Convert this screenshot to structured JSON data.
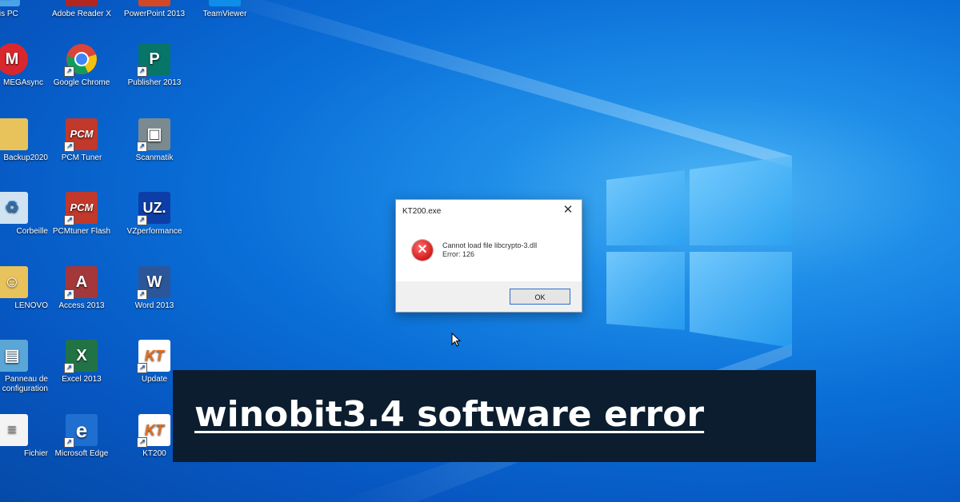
{
  "desktop": {
    "icons": [
      {
        "label": "This PC",
        "icon": "computer-icon"
      },
      {
        "label": "Adobe Reader X",
        "icon": "pdf-icon"
      },
      {
        "label": "PowerPoint 2013",
        "icon": "powerpoint-icon"
      },
      {
        "label": "TeamViewer",
        "icon": "teamviewer-icon"
      },
      {
        "label": "MEGAsync",
        "icon": "mega-icon",
        "color": "#d9272e",
        "glyph": "M"
      },
      {
        "label": "Google Chrome",
        "icon": "chrome-icon"
      },
      {
        "label": "Publisher 2013",
        "icon": "publisher-icon",
        "color": "#077568",
        "glyph": "P"
      },
      {
        "label": "Backup2020",
        "icon": "folder-icon"
      },
      {
        "label": "PCM Tuner",
        "icon": "pcm-tuner-icon",
        "color": "#c0392b",
        "glyph": "PCM"
      },
      {
        "label": "Scanmatik",
        "icon": "scanmatik-icon"
      },
      {
        "label": "Corbeille",
        "icon": "recycle-bin-icon"
      },
      {
        "label": "PCMtuner Flash",
        "icon": "pcm-flash-icon",
        "color": "#c0392b",
        "glyph": "PCM"
      },
      {
        "label": "VZperformance",
        "icon": "vz-icon",
        "color": "#0d3ea8",
        "glyph": "UZ."
      },
      {
        "label": "LENOVO",
        "icon": "user-folder-icon"
      },
      {
        "label": "Access 2013",
        "icon": "access-icon",
        "color": "#a4373a",
        "glyph": "A"
      },
      {
        "label": "Word 2013",
        "icon": "word-icon",
        "color": "#2b579a",
        "glyph": "W"
      },
      {
        "label": "Panneau de configuration",
        "icon": "control-panel-icon"
      },
      {
        "label": "Excel 2013",
        "icon": "excel-icon",
        "color": "#217346",
        "glyph": "X"
      },
      {
        "label": "Update",
        "icon": "kt-update-icon",
        "glyph": "KT"
      },
      {
        "label": "Fichier",
        "icon": "document-icon"
      },
      {
        "label": "Microsoft Edge",
        "icon": "edge-icon",
        "color": "#1f6fd1",
        "glyph": "e"
      },
      {
        "label": "KT200",
        "icon": "kt200-icon",
        "glyph": "KT"
      }
    ]
  },
  "dialog": {
    "title": "KT200.exe",
    "close_glyph": "✕",
    "message_line1": "Cannot load file libcrypto-3.dll",
    "message_line2": "Error: 126",
    "ok_label": "OK",
    "error_glyph": "✕"
  },
  "banner": {
    "text": "winobit3.4 software error"
  },
  "colors": {
    "desktop_blue": "#0a6fd8",
    "banner_bg": "#0b1d2e",
    "error_red": "#d41b1b"
  }
}
